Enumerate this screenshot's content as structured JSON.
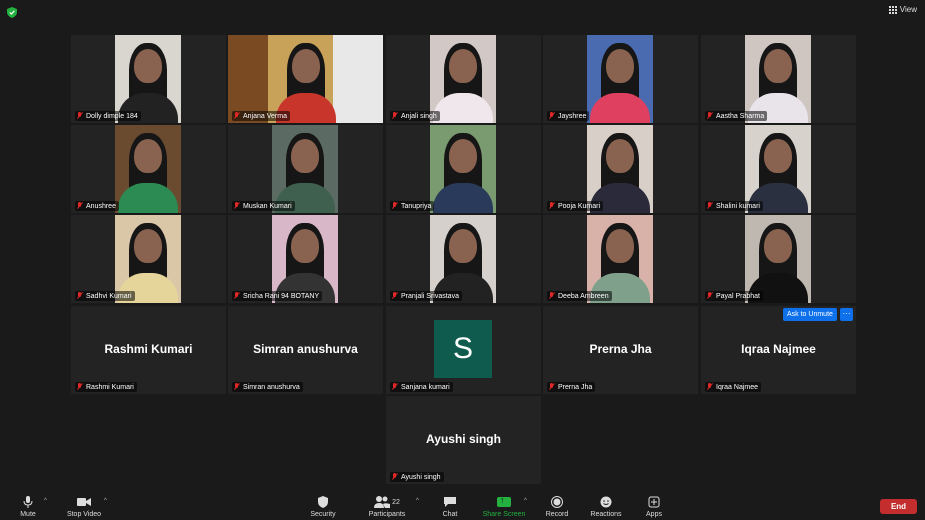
{
  "view_button": {
    "label": "View"
  },
  "participants": [
    {
      "name": "Dolly dimple  184",
      "type": "video"
    },
    {
      "name": "Anjana Verma",
      "type": "video",
      "active": true
    },
    {
      "name": "Anjali singh",
      "type": "video"
    },
    {
      "name": "Jayshree",
      "type": "video"
    },
    {
      "name": "Aastha Sharma",
      "type": "video"
    },
    {
      "name": "Anushree",
      "type": "video"
    },
    {
      "name": "Muskan Kumari",
      "type": "video"
    },
    {
      "name": "Tanupriya",
      "type": "video"
    },
    {
      "name": "Pooja Kumari",
      "type": "video"
    },
    {
      "name": "Shalini kumari",
      "type": "video"
    },
    {
      "name": "Sadhvi Kumari",
      "type": "video"
    },
    {
      "name": "Sricha Rani 94 BOTANY",
      "type": "video"
    },
    {
      "name": "Pranjali Srivastava",
      "type": "video"
    },
    {
      "name": "Deeba Ambreen",
      "type": "video"
    },
    {
      "name": "Payal Prabhat",
      "type": "video"
    },
    {
      "name": "Rashmi Kumari",
      "display": "Rashmi Kumari",
      "type": "name"
    },
    {
      "name": "Simran anushurva",
      "display": "Simran anushurva",
      "type": "name"
    },
    {
      "name": "Sanjana kumari",
      "display": "S",
      "type": "avatar"
    },
    {
      "name": "Prerna Jha",
      "display": "Prerna Jha",
      "type": "name"
    },
    {
      "name": "Iqraa Najmee",
      "display": "Iqraa Najmee",
      "type": "name"
    },
    {
      "name": "Ayushi singh",
      "display": "Ayushi singh",
      "type": "name"
    }
  ],
  "overlay": {
    "ask_to_unmute": "Ask to Unmute",
    "more": "···"
  },
  "toolbar": {
    "mute": "Mute",
    "stop_video": "Stop Video",
    "security": "Security",
    "participants": "Participants",
    "participants_count": "22",
    "chat": "Chat",
    "share_screen": "Share Screen",
    "record": "Record",
    "reactions": "Reactions",
    "apps": "Apps",
    "end": "End"
  },
  "colors": {
    "accent": "#0e71eb",
    "active_border": "#c7d833",
    "share": "#23b140",
    "end": "#c42d2d",
    "avatar_bg": "#0f5c4e"
  }
}
